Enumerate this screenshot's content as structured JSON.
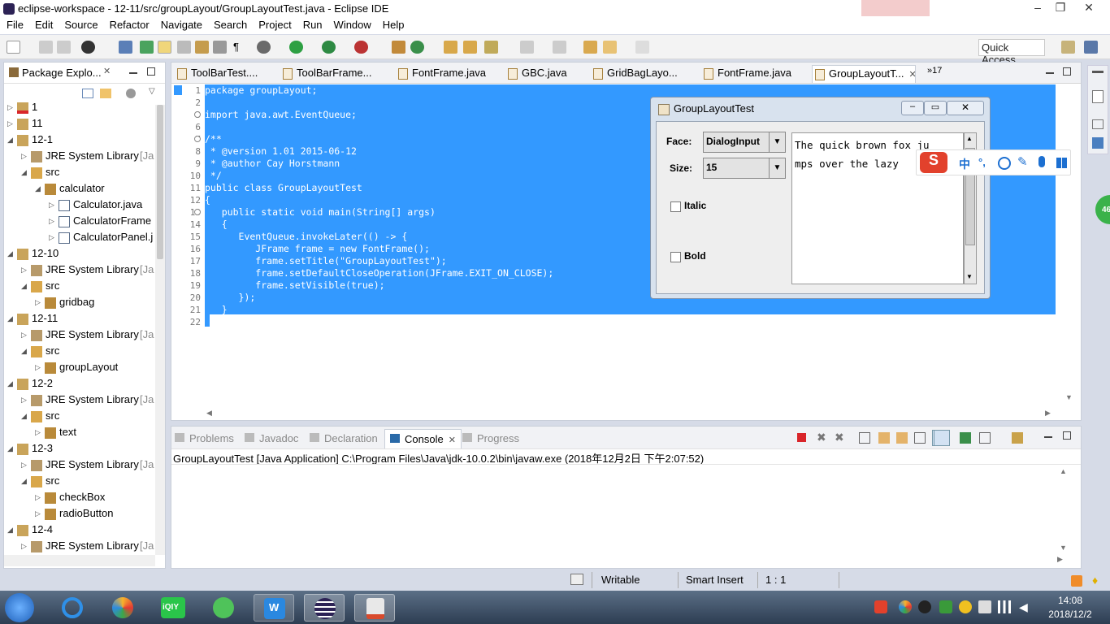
{
  "window": {
    "title": "eclipse-workspace - 12-11/src/groupLayout/GroupLayoutTest.java - Eclipse IDE"
  },
  "menu": [
    "File",
    "Edit",
    "Source",
    "Refactor",
    "Navigate",
    "Search",
    "Project",
    "Run",
    "Window",
    "Help"
  ],
  "toolbar": {
    "quick_access": "Quick Access"
  },
  "package_explorer": {
    "title": "Package Explo...",
    "rows": [
      {
        "label": "1",
        "depth": 0,
        "kind": "project",
        "expanded": false
      },
      {
        "label": "11",
        "depth": 0,
        "kind": "project",
        "expanded": false
      },
      {
        "label": "12-1",
        "depth": 0,
        "kind": "project",
        "expanded": true
      },
      {
        "label": "JRE System Library",
        "suffix": "[Ja",
        "depth": 1,
        "kind": "lib",
        "expanded": false
      },
      {
        "label": "src",
        "depth": 1,
        "kind": "src",
        "expanded": true
      },
      {
        "label": "calculator",
        "depth": 2,
        "kind": "pkg",
        "expanded": true
      },
      {
        "label": "Calculator.java",
        "depth": 3,
        "kind": "java",
        "expanded": false
      },
      {
        "label": "CalculatorFrame",
        "depth": 3,
        "kind": "java",
        "expanded": false
      },
      {
        "label": "CalculatorPanel.j",
        "depth": 3,
        "kind": "java",
        "expanded": false
      },
      {
        "label": "12-10",
        "depth": 0,
        "kind": "project",
        "expanded": true
      },
      {
        "label": "JRE System Library",
        "suffix": "[Ja",
        "depth": 1,
        "kind": "lib",
        "expanded": false
      },
      {
        "label": "src",
        "depth": 1,
        "kind": "src",
        "expanded": true
      },
      {
        "label": "gridbag",
        "depth": 2,
        "kind": "pkg",
        "expanded": false
      },
      {
        "label": "12-11",
        "depth": 0,
        "kind": "project",
        "expanded": true
      },
      {
        "label": "JRE System Library",
        "suffix": "[Ja",
        "depth": 1,
        "kind": "lib",
        "expanded": false
      },
      {
        "label": "src",
        "depth": 1,
        "kind": "src",
        "expanded": true
      },
      {
        "label": "groupLayout",
        "depth": 2,
        "kind": "pkg",
        "expanded": false
      },
      {
        "label": "12-2",
        "depth": 0,
        "kind": "project",
        "expanded": true
      },
      {
        "label": "JRE System Library",
        "suffix": "[Ja",
        "depth": 1,
        "kind": "lib",
        "expanded": false
      },
      {
        "label": "src",
        "depth": 1,
        "kind": "src",
        "expanded": true
      },
      {
        "label": "text",
        "depth": 2,
        "kind": "pkg",
        "expanded": false
      },
      {
        "label": "12-3",
        "depth": 0,
        "kind": "project",
        "expanded": true
      },
      {
        "label": "JRE System Library",
        "suffix": "[Ja",
        "depth": 1,
        "kind": "lib",
        "expanded": false
      },
      {
        "label": "src",
        "depth": 1,
        "kind": "src",
        "expanded": true
      },
      {
        "label": "checkBox",
        "depth": 2,
        "kind": "pkg",
        "expanded": false
      },
      {
        "label": "radioButton",
        "depth": 2,
        "kind": "pkg",
        "expanded": false
      },
      {
        "label": "12-4",
        "depth": 0,
        "kind": "project",
        "expanded": true
      },
      {
        "label": "JRE System Library",
        "suffix": "[Ja",
        "depth": 1,
        "kind": "lib",
        "expanded": false
      }
    ]
  },
  "editor": {
    "tabs": [
      {
        "label": "ToolBarTest....",
        "active": false
      },
      {
        "label": "ToolBarFrame...",
        "active": false
      },
      {
        "label": "FontFrame.java",
        "active": false
      },
      {
        "label": "GBC.java",
        "active": false
      },
      {
        "label": "GridBagLayo...",
        "active": false
      },
      {
        "label": "FontFrame.java",
        "active": false
      },
      {
        "label": "GroupLayoutT...",
        "active": true
      }
    ],
    "overflow": "»17",
    "line_numbers": [
      "1",
      "2",
      "3",
      "6",
      "7",
      "8",
      "9",
      "10",
      "11",
      "12",
      "13",
      "14",
      "15",
      "16",
      "17",
      "18",
      "19",
      "20",
      "21",
      "22"
    ],
    "code_lines": [
      "package groupLayout;",
      "",
      "import java.awt.EventQueue;",
      "",
      "/**",
      " * @version 1.01 2015-06-12",
      " * @author Cay Horstmann",
      " */",
      "public class GroupLayoutTest",
      "{",
      "   public static void main(String[] args)",
      "   {",
      "      EventQueue.invokeLater(() -> {",
      "         JFrame frame = new FontFrame();",
      "         frame.setTitle(\"GroupLayoutTest\");",
      "         frame.setDefaultCloseOperation(JFrame.EXIT_ON_CLOSE);",
      "         frame.setVisible(true);",
      "      });",
      "   }",
      "}"
    ]
  },
  "bottom": {
    "tabs": [
      {
        "label": "Problems",
        "active": false
      },
      {
        "label": "Javadoc",
        "active": false
      },
      {
        "label": "Declaration",
        "active": false
      },
      {
        "label": "Console",
        "active": true
      },
      {
        "label": "Progress",
        "active": false
      }
    ],
    "console_header": "GroupLayoutTest [Java Application] C:\\Program Files\\Java\\jdk-10.0.2\\bin\\javaw.exe (2018年12月2日 下午2:07:52)"
  },
  "statusbar": {
    "writable": "Writable",
    "insert_mode": "Smart Insert",
    "position": "1 : 1"
  },
  "dialog": {
    "title": "GroupLayoutTest",
    "face_label": "Face:",
    "face_value": "DialogInput",
    "size_label": "Size:",
    "size_value": "15",
    "italic_label": "Italic",
    "bold_label": "Bold",
    "text_line1": "The quick brown fox ju",
    "text_line2": "mps over the lazy"
  },
  "ime": {
    "mode": "中",
    "punct": "°,"
  },
  "badge": "46",
  "taskbar": {
    "time": "14:08",
    "date": "2018/12/2"
  },
  "colors": {
    "selection": "#3399ff",
    "background": "#d6dbe7",
    "accent_red": "#e2412c"
  }
}
